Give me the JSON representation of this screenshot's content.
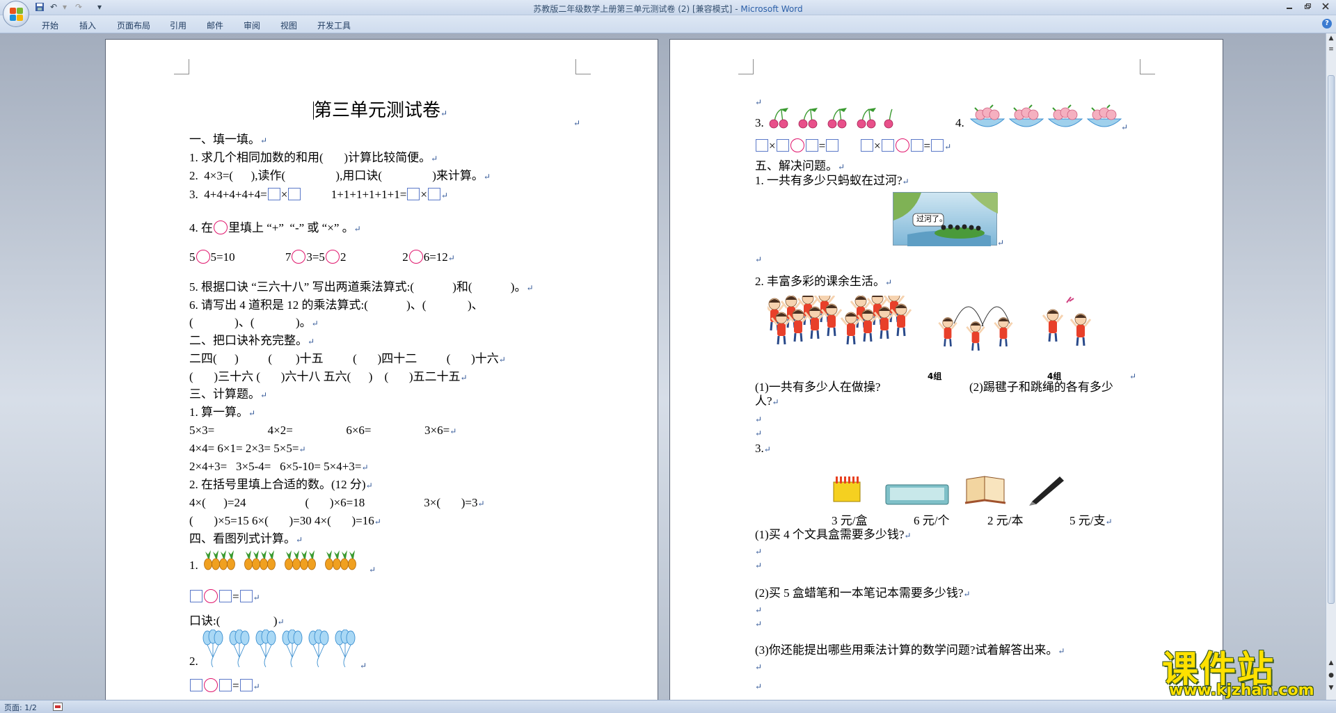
{
  "window": {
    "title": "苏教版二年级数学上册第三单元测试卷 (2) [兼容模式]",
    "title_sep": " - ",
    "app": "Microsoft Word"
  },
  "quick_access": {
    "undo": "↶",
    "redo": "↷",
    "dropdown": "▾"
  },
  "ribbon": {
    "tabs": [
      "开始",
      "插入",
      "页面布局",
      "引用",
      "邮件",
      "审阅",
      "视图",
      "开发工具"
    ]
  },
  "status": {
    "page": "页面: 1/2"
  },
  "watermark": {
    "main": "课件站",
    "url": "www.kjzhan.com"
  },
  "marks": {
    "para": "↵"
  },
  "page1": {
    "title": "第三单元测试卷",
    "s1": "一、填一填。",
    "q1": "1. 求几个相同加数的和用(       )计算比较简便。",
    "q2": "2.  4×3=(      ),读作(                 ),用口诀(                 )来计算。",
    "q3a": "3.  4+4+4+4+4=",
    "q3b": "1+1+1+1+1+1=",
    "times": "×",
    "q4a": "4. 在",
    "q4b": "里填上 “+”  “-” 或 “×” 。",
    "q4c1a": "5",
    "q4c1b": "5=10",
    "q4c2a": "7",
    "q4c2b": "3=5",
    "q4c2c": "2",
    "q4c3a": "2",
    "q4c3b": "6=12",
    "q5": "5. 根据口诀 “三六十八” 写出两道乘法算式:(             )和(             )。",
    "q6a": "6. 请写出 4 道积是 12 的乘法算式:(             )、(              )、",
    "q6b": "(              )、(              )。",
    "s2": "二、把口诀补充完整。",
    "s2r1": "二四(      )          (        )十五          (       )四十二          (       )十六",
    "s2r2": "(       )三十六 (       )六十八 五六(      )    (       )五二十五",
    "s3": "三、计算题。",
    "s3q1": "1. 算一算。",
    "c1": "5×3=                  4×2=                  6×6=                  3×6=",
    "c2": "4×4= 6×1= 2×3= 5×5=",
    "c3": "2×4+3=   3×5-4=   6×5-10= 5×4+3=",
    "s3q2": "2. 在括号里填上合适的数。(12 分)",
    "f1": "4×(      )=24                    (       )×6=18                    3×(       )=3",
    "f2": "(       )×5=15 6×(       )=30 4×(       )=16",
    "s4": "四、看图列式计算。",
    "s4q1": "1.",
    "equals": "=",
    "koujue": "口诀:(                  )",
    "s4q2": "2."
  },
  "page2": {
    "q3label": "3.",
    "q4label": "4.",
    "times": "×",
    "equals": "=",
    "s5": "五、解决问题。",
    "p1": "1. 一共有多少只蚂蚁在过河?",
    "ant_caption": "过河了。",
    "p2": "2. 丰富多彩的课余生活。",
    "group1": "4组",
    "group2": "4组",
    "p2a": "(1)一共有多少人在做操?",
    "p2b": "(2)踢毽子和跳绳的各有多少",
    "p2b2": "人?",
    "p3": "3.",
    "price1": "3 元/盒",
    "price2": "6 元/个",
    "price3": "2 元/本",
    "price4": "5 元/支",
    "p3a": "(1)买 4 个文具盒需要多少钱?",
    "p3b": "(2)买 5 盒蜡笔和一本笔记本需要多少钱?",
    "p3c": "(3)你还能提出哪些用乘法计算的数学问题?试着解答出来。"
  }
}
